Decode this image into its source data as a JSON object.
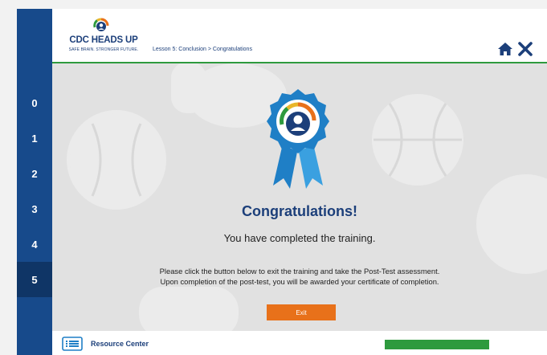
{
  "logo": {
    "title": "CDC HEADS UP",
    "tagline": "SAFE BRAIN. STRONGER FUTURE."
  },
  "breadcrumb": "Lesson 5: Conclusion > Congratulations",
  "nav": {
    "items": [
      "0",
      "1",
      "2",
      "3",
      "4",
      "5"
    ],
    "active": "5"
  },
  "header_icons": {
    "home": "home-icon",
    "close": "close-icon"
  },
  "content": {
    "title": "Congratulations!",
    "subtitle": "You have completed the training.",
    "instructions_line1": "Please click the button below to exit the training and take the Post-Test assessment.",
    "instructions_line2": "Upon completion of the post-test, you will be awarded your certificate of completion.",
    "exit_label": "Exit"
  },
  "footer": {
    "resource_label": "Resource Center",
    "progress": 1.0
  },
  "colors": {
    "nav_blue": "#174a8b",
    "brand_blue": "#1c3f7a",
    "accent_green": "#2e9a3e",
    "exit_orange": "#e8711a",
    "ribbon_blue": "#1f7fc6"
  }
}
